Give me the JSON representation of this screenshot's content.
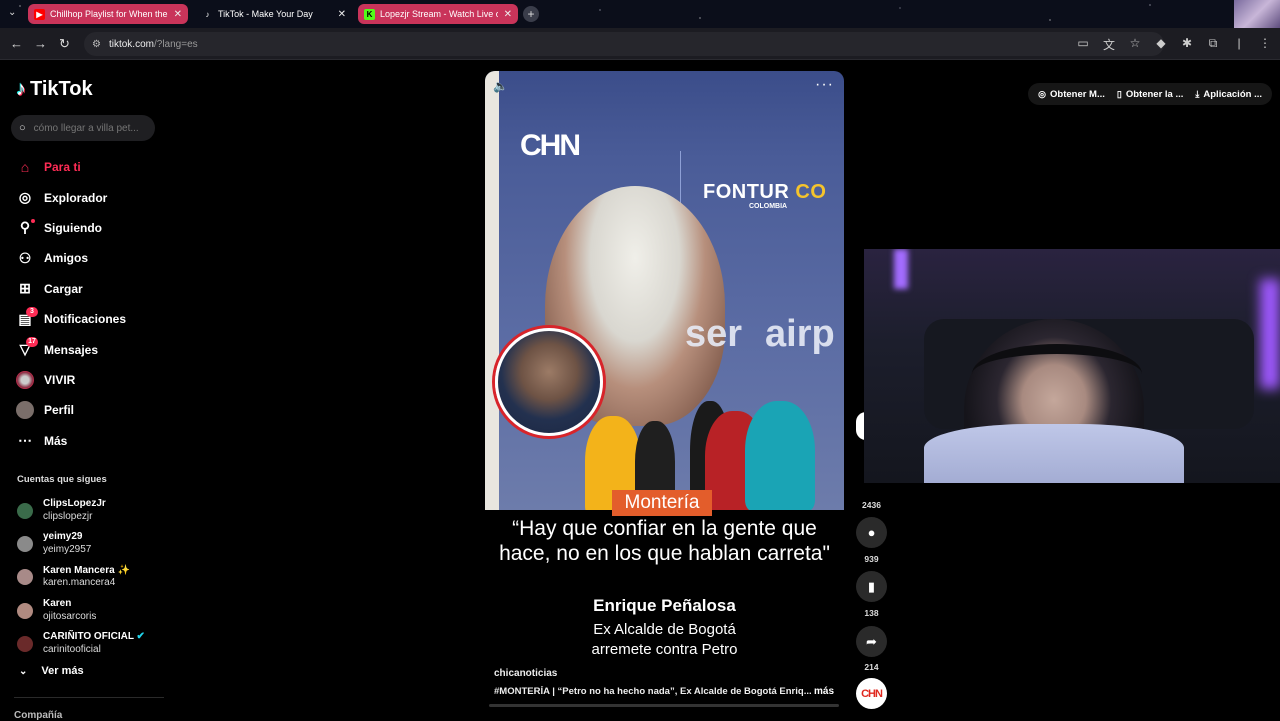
{
  "browser": {
    "tabs": [
      {
        "label": "Chillhop Playlist for When the",
        "favicon": "youtube-icon",
        "color": "#ff0000"
      },
      {
        "label": "TikTok - Make Your Day",
        "favicon": "tiktok-icon",
        "color": "#000000"
      },
      {
        "label": "Lopezjr Stream - Watch Live o",
        "favicon": "kick-icon",
        "color": "#53fc18"
      }
    ],
    "url_host": "tiktok.com",
    "url_path": "/?lang=es"
  },
  "tiktok": {
    "logo": "TikTok",
    "search_placeholder": "cómo llegar a villa pet...",
    "nav": [
      {
        "label": "Para ti",
        "icon": "home-icon"
      },
      {
        "label": "Explorador",
        "icon": "compass-icon"
      },
      {
        "label": "Siguiendo",
        "icon": "following-icon"
      },
      {
        "label": "Amigos",
        "icon": "friends-icon"
      },
      {
        "label": "Cargar",
        "icon": "upload-icon"
      },
      {
        "label": "Notificaciones",
        "icon": "inbox-icon",
        "badge": "3"
      },
      {
        "label": "Mensajes",
        "icon": "send-icon",
        "badge": "17"
      },
      {
        "label": "VIVIR",
        "icon": "live-icon"
      },
      {
        "label": "Perfil",
        "icon": "profile-avatar"
      },
      {
        "label": "Más",
        "icon": "more-icon"
      }
    ],
    "following_title": "Cuentas que sigues",
    "following": [
      {
        "name": "ClipsLopezJr",
        "handle": "clipslopezjr"
      },
      {
        "name": "yeimy29",
        "handle": "yeimy2957"
      },
      {
        "name": "Karen Mancera ✨",
        "handle": "karen.mancera4"
      },
      {
        "name": "Karen",
        "handle": "ojitosarcoris"
      },
      {
        "name": "CARIÑITO OFICIAL",
        "handle": "carinitooficial"
      }
    ],
    "see_more": "Ver más",
    "company": "Compañía",
    "top_buttons": [
      "Obtener M...",
      "Obtener la ...",
      "Aplicación ..."
    ]
  },
  "video": {
    "brand": "CHN",
    "sponsor": "FONTUR",
    "sponsor_co": "CO",
    "sponsor_sub": "COLOMBIA",
    "wall_text_1": "ser",
    "wall_text_2": "airp",
    "place": "Montería",
    "quote": "“Hay que confiar en la gente que hace, no en los que hablan carreta\"",
    "speaker": "Enrique Peñalosa",
    "role_1": "Ex Alcalde de Bogotá",
    "role_2": "arremete contra Petro",
    "author": "chicanoticias",
    "description": "#MONTERÍA | “Petro no ha hecho nada”, Ex Alcalde de Bogotá Enriq...",
    "more": "más"
  },
  "actions": {
    "likes": "2436",
    "comments": "939",
    "saves": "138",
    "shares": "214",
    "creator_avatar": "CHN"
  }
}
